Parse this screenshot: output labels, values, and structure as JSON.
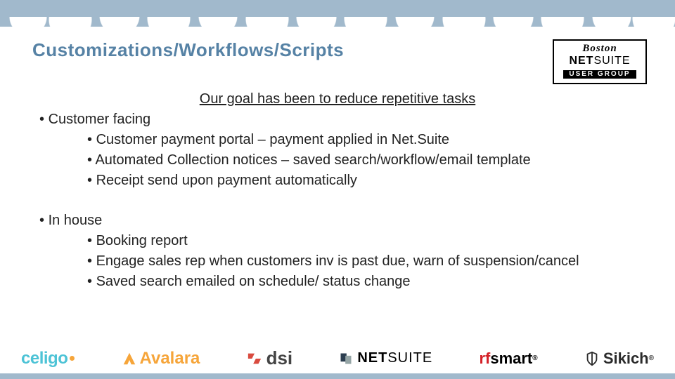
{
  "header": {
    "title": "Customizations/Workflows/Scripts",
    "logo": {
      "line1": "Boston",
      "line2_bold": "NET",
      "line2_light": "SUITE",
      "badge": "USER GROUP"
    }
  },
  "body": {
    "goal": "Our goal has been to reduce repetitive tasks",
    "groups": [
      {
        "label": "Customer facing",
        "items": [
          "Customer payment portal – payment applied in Net.Suite",
          "Automated Collection notices – saved search/workflow/email template",
          "Receipt send upon payment automatically"
        ]
      },
      {
        "label": "In house",
        "items": [
          "Booking report",
          "Engage sales rep when customers inv is past due, warn of suspension/cancel",
          "Saved search emailed on schedule/ status change"
        ]
      }
    ]
  },
  "footer": {
    "logos": {
      "celigo": "celigo",
      "avalara": "Avalara",
      "dsi": "dsi",
      "netsuite_bold": "NET",
      "netsuite_light": "SUITE",
      "rfsmart_rf": "rf",
      "rfsmart_rest": "smart",
      "sikich": "Sikich"
    }
  }
}
